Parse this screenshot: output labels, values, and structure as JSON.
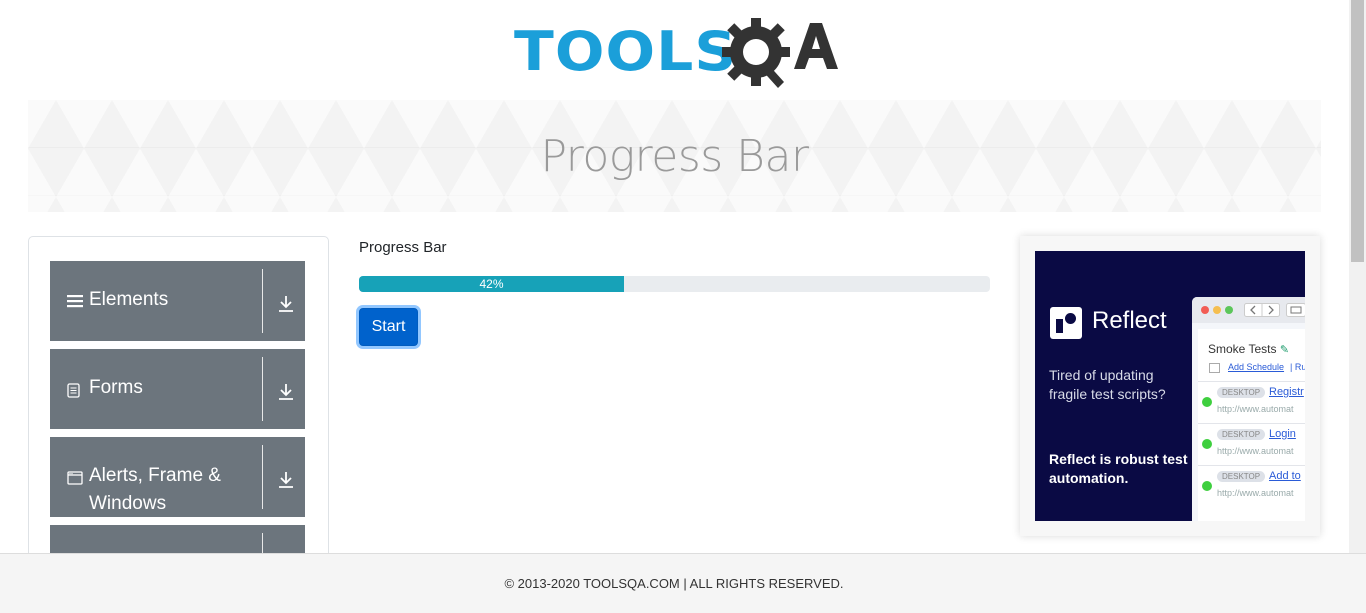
{
  "logo": {
    "tools_text": "TOOLS",
    "brand_alt": "ToolsQA"
  },
  "banner": {
    "title": "Progress Bar"
  },
  "sidebar": {
    "groups": [
      {
        "label": "Elements",
        "icon": "hamburger-icon"
      },
      {
        "label": "Forms",
        "icon": "document-icon"
      },
      {
        "label_line1": "Alerts, Frame &",
        "label_line2": "Windows",
        "icon": "window-icon"
      },
      {
        "label": "",
        "icon": ""
      }
    ]
  },
  "main": {
    "title": "Progress Bar",
    "progress": {
      "value": 42,
      "label": "42%"
    },
    "start_button": "Start"
  },
  "ad": {
    "brand": "Reflect",
    "tagline": "Tired of updating fragile test scripts?",
    "cta": "Reflect is robust test automation.",
    "window": {
      "panel_title": "Smoke Tests",
      "schedule_link": "Add Schedule",
      "schedule_trailing": "| Ru",
      "rows": [
        {
          "badge": "DESKTOP",
          "name": "Registr",
          "url": "http://www.automat"
        },
        {
          "badge": "DESKTOP",
          "name": "Login",
          "url": "http://www.automat"
        },
        {
          "badge": "DESKTOP",
          "name": "Add to",
          "url": "http://www.automat"
        }
      ]
    }
  },
  "footer": {
    "copyright": "© 2013-2020 TOOLSQA.COM | ALL RIGHTS RESERVED."
  },
  "colors": {
    "progress_fill": "#17a2b8",
    "button": "#0062cc",
    "sidebar_group": "#6c757d",
    "logo_blue": "#1b9fd9"
  }
}
